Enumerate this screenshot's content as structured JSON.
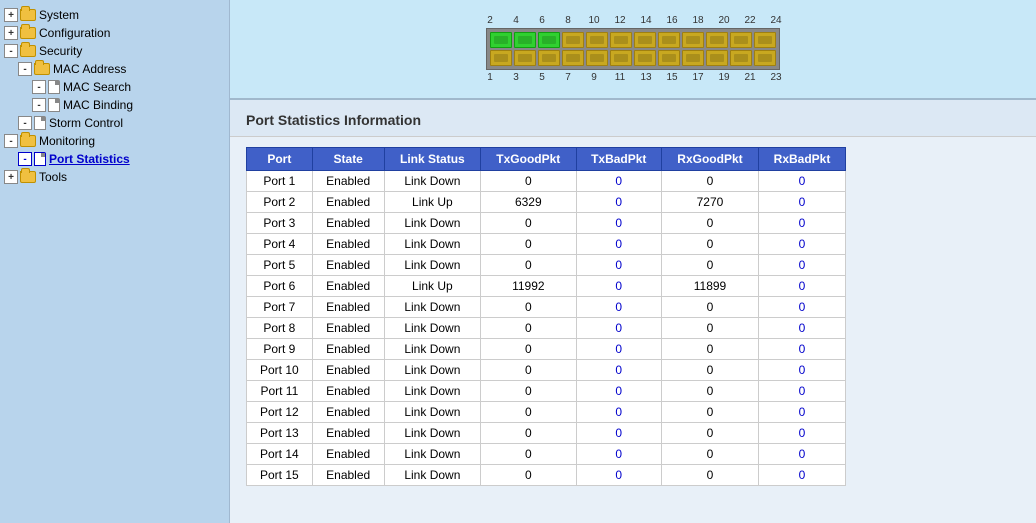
{
  "sidebar": {
    "items": [
      {
        "id": "system",
        "label": "System",
        "level": 0,
        "type": "expand-folder",
        "expand": "+",
        "active": false
      },
      {
        "id": "configuration",
        "label": "Configuration",
        "level": 0,
        "type": "expand-folder",
        "expand": "+",
        "active": false
      },
      {
        "id": "security",
        "label": "Security",
        "level": 0,
        "type": "expand-folder",
        "expand": "-",
        "active": false
      },
      {
        "id": "mac-address",
        "label": "MAC Address",
        "level": 1,
        "type": "expand-folder",
        "expand": "-",
        "active": false
      },
      {
        "id": "mac-search",
        "label": "MAC Search",
        "level": 2,
        "type": "doc",
        "active": false
      },
      {
        "id": "mac-binding",
        "label": "MAC Binding",
        "level": 2,
        "type": "doc",
        "active": false
      },
      {
        "id": "storm-control",
        "label": "Storm Control",
        "level": 1,
        "type": "expand-doc",
        "expand": "-",
        "active": false
      },
      {
        "id": "monitoring",
        "label": "Monitoring",
        "level": 0,
        "type": "expand-folder",
        "expand": "-",
        "active": false
      },
      {
        "id": "port-statistics",
        "label": "Port Statistics",
        "level": 1,
        "type": "doc",
        "active": true
      },
      {
        "id": "tools",
        "label": "Tools",
        "level": 0,
        "type": "expand-folder",
        "expand": "+",
        "active": false
      }
    ]
  },
  "device": {
    "ports_top": [
      "2",
      "4",
      "6",
      "8",
      "10",
      "12",
      "14",
      "16",
      "18",
      "20",
      "22",
      "24"
    ],
    "ports_bottom": [
      "1",
      "3",
      "5",
      "7",
      "9",
      "11",
      "13",
      "15",
      "17",
      "19",
      "21",
      "23"
    ],
    "active_ports": [
      2,
      4,
      6
    ]
  },
  "page": {
    "title": "Port Statistics Information"
  },
  "table": {
    "headers": [
      "Port",
      "State",
      "Link Status",
      "TxGoodPkt",
      "TxBadPkt",
      "RxGoodPkt",
      "RxBadPkt"
    ],
    "rows": [
      {
        "port": "Port 1",
        "state": "Enabled",
        "link_status": "Link Down",
        "tx_good": "0",
        "tx_bad": "0",
        "rx_good": "0",
        "rx_bad": "0"
      },
      {
        "port": "Port 2",
        "state": "Enabled",
        "link_status": "Link Up",
        "tx_good": "6329",
        "tx_bad": "0",
        "rx_good": "7270",
        "rx_bad": "0"
      },
      {
        "port": "Port 3",
        "state": "Enabled",
        "link_status": "Link Down",
        "tx_good": "0",
        "tx_bad": "0",
        "rx_good": "0",
        "rx_bad": "0"
      },
      {
        "port": "Port 4",
        "state": "Enabled",
        "link_status": "Link Down",
        "tx_good": "0",
        "tx_bad": "0",
        "rx_good": "0",
        "rx_bad": "0"
      },
      {
        "port": "Port 5",
        "state": "Enabled",
        "link_status": "Link Down",
        "tx_good": "0",
        "tx_bad": "0",
        "rx_good": "0",
        "rx_bad": "0"
      },
      {
        "port": "Port 6",
        "state": "Enabled",
        "link_status": "Link Up",
        "tx_good": "11992",
        "tx_bad": "0",
        "rx_good": "11899",
        "rx_bad": "0"
      },
      {
        "port": "Port 7",
        "state": "Enabled",
        "link_status": "Link Down",
        "tx_good": "0",
        "tx_bad": "0",
        "rx_good": "0",
        "rx_bad": "0"
      },
      {
        "port": "Port 8",
        "state": "Enabled",
        "link_status": "Link Down",
        "tx_good": "0",
        "tx_bad": "0",
        "rx_good": "0",
        "rx_bad": "0"
      },
      {
        "port": "Port 9",
        "state": "Enabled",
        "link_status": "Link Down",
        "tx_good": "0",
        "tx_bad": "0",
        "rx_good": "0",
        "rx_bad": "0"
      },
      {
        "port": "Port 10",
        "state": "Enabled",
        "link_status": "Link Down",
        "tx_good": "0",
        "tx_bad": "0",
        "rx_good": "0",
        "rx_bad": "0"
      },
      {
        "port": "Port 11",
        "state": "Enabled",
        "link_status": "Link Down",
        "tx_good": "0",
        "tx_bad": "0",
        "rx_good": "0",
        "rx_bad": "0"
      },
      {
        "port": "Port 12",
        "state": "Enabled",
        "link_status": "Link Down",
        "tx_good": "0",
        "tx_bad": "0",
        "rx_good": "0",
        "rx_bad": "0"
      },
      {
        "port": "Port 13",
        "state": "Enabled",
        "link_status": "Link Down",
        "tx_good": "0",
        "tx_bad": "0",
        "rx_good": "0",
        "rx_bad": "0"
      },
      {
        "port": "Port 14",
        "state": "Enabled",
        "link_status": "Link Down",
        "tx_good": "0",
        "tx_bad": "0",
        "rx_good": "0",
        "rx_bad": "0"
      },
      {
        "port": "Port 15",
        "state": "Enabled",
        "link_status": "Link Down",
        "tx_good": "0",
        "tx_bad": "0",
        "rx_good": "0",
        "rx_bad": "0"
      }
    ]
  }
}
